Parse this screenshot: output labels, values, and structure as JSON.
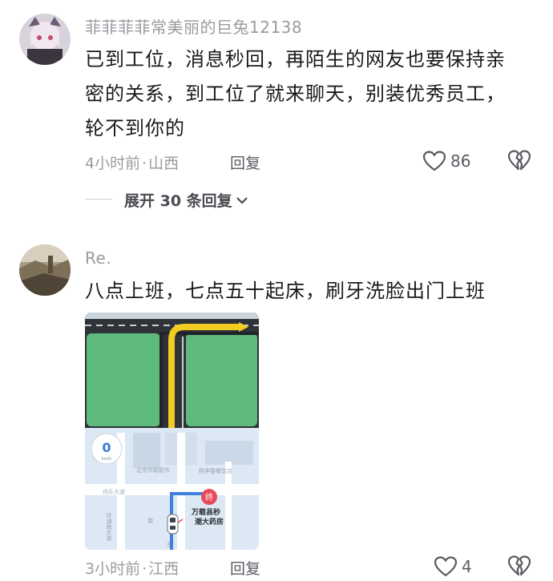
{
  "comments": [
    {
      "username": "菲菲菲菲常美丽的巨兔12138",
      "text_lines": [
        "已到工位，消息秒回，再陌生的网友也要保持亲",
        "密的关系，到工位了就来聊天，别装优秀员工，",
        "轮不到你的"
      ],
      "time": "4小时前",
      "location": "山西",
      "reply_label": "回复",
      "likes": "86",
      "expand_label": "展开 30 条回复"
    },
    {
      "username": "Re.",
      "text_lines": [
        "八点上班，七点五十起床，刷牙洗脸出门上班"
      ],
      "time": "3小时前",
      "location": "江西",
      "reply_label": "回复",
      "likes": "4",
      "image": {
        "speed_value": "0",
        "speed_unit": "km/h",
        "dest_marker": "终",
        "dest_label_line1": "万载县秒",
        "dest_label_line2": "潮大药房",
        "map_labels": [
          "伟乐大道",
          "环湖南大道",
          "南",
          "东",
          "北京华联超市",
          "桃李春餐饮店"
        ]
      }
    }
  ],
  "separator": "·",
  "colors": {
    "road_green": "#5fba7d",
    "route_yellow": "#f2cc21",
    "map_blue": "#dce8f4",
    "marker_red": "#e84c5a"
  }
}
